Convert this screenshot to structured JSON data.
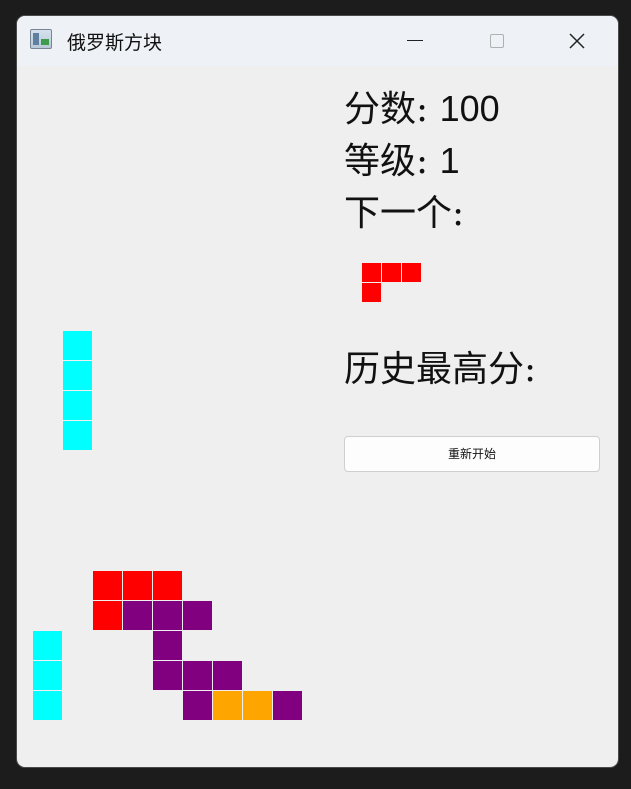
{
  "window": {
    "title": "俄罗斯方块",
    "controls": [
      "minimize",
      "maximize",
      "close"
    ]
  },
  "sidebar": {
    "score_label": "分数:",
    "score_value": "100",
    "level_label": "等级:",
    "level_value": "1",
    "next_label": "下一个:",
    "high_score_label": "历史最高分:",
    "restart_label": "重新开始"
  },
  "colors": {
    "cyan": "#00ffff",
    "red": "#ff0000",
    "purple": "#800080",
    "orange": "#ffa500"
  },
  "board": {
    "columns": 10,
    "rows": 22,
    "cells": [
      {
        "col": 1,
        "row": 9,
        "color": "cyan"
      },
      {
        "col": 1,
        "row": 10,
        "color": "cyan"
      },
      {
        "col": 1,
        "row": 11,
        "color": "cyan"
      },
      {
        "col": 1,
        "row": 12,
        "color": "cyan"
      },
      {
        "col": 2,
        "row": 17,
        "color": "red"
      },
      {
        "col": 3,
        "row": 17,
        "color": "red"
      },
      {
        "col": 4,
        "row": 17,
        "color": "red"
      },
      {
        "col": 2,
        "row": 18,
        "color": "red"
      },
      {
        "col": 3,
        "row": 18,
        "color": "purple"
      },
      {
        "col": 4,
        "row": 18,
        "color": "purple"
      },
      {
        "col": 5,
        "row": 18,
        "color": "purple"
      },
      {
        "col": 0,
        "row": 19,
        "color": "cyan"
      },
      {
        "col": 4,
        "row": 19,
        "color": "purple"
      },
      {
        "col": 0,
        "row": 20,
        "color": "cyan"
      },
      {
        "col": 4,
        "row": 20,
        "color": "purple"
      },
      {
        "col": 5,
        "row": 20,
        "color": "purple"
      },
      {
        "col": 6,
        "row": 20,
        "color": "purple"
      },
      {
        "col": 0,
        "row": 21,
        "color": "cyan"
      },
      {
        "col": 5,
        "row": 21,
        "color": "purple"
      },
      {
        "col": 6,
        "row": 21,
        "color": "orange"
      },
      {
        "col": 7,
        "row": 21,
        "color": "orange"
      },
      {
        "col": 8,
        "row": 21,
        "color": "purple"
      }
    ]
  },
  "next_piece": {
    "color": "red",
    "cells": [
      {
        "col": 0,
        "row": 0
      },
      {
        "col": 1,
        "row": 0
      },
      {
        "col": 2,
        "row": 0
      },
      {
        "col": 0,
        "row": 1
      }
    ]
  }
}
